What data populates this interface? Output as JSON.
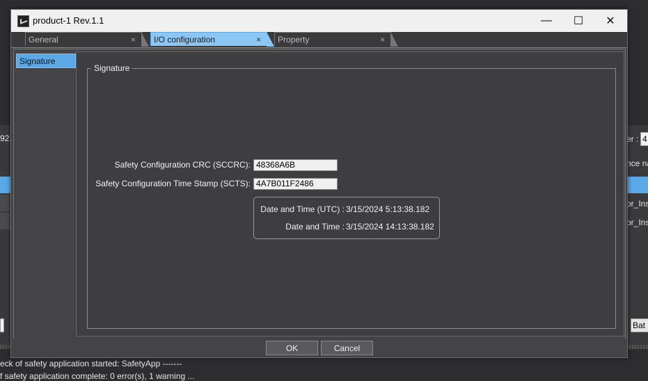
{
  "background": {
    "left_fragment": "92.1",
    "right_label": "er :",
    "right_value": "4",
    "column_fragment": "nce na",
    "row1": "or_Ins",
    "row2": "or_Ins",
    "button_fragment": "Bat",
    "log_line1": "eck of safety application started: SafetyApp -------",
    "log_line2": "f safety application complete: 0 error(s), 1 warning ..."
  },
  "window": {
    "title": "product-1 Rev.1.1",
    "minimize": "—",
    "maximize": "☐",
    "close": "✕"
  },
  "tabs": [
    {
      "label": "General",
      "close": "×",
      "active": false
    },
    {
      "label": "I/O configuration",
      "close": "×",
      "active": true
    },
    {
      "label": "Property",
      "close": "×",
      "active": false
    }
  ],
  "nav": {
    "items": [
      {
        "label": "Signature"
      }
    ]
  },
  "signature": {
    "group_title": "Signature",
    "crc_label": "Safety Configuration CRC (SCCRC):",
    "crc_value": "48368A6B",
    "ts_label": "Safety Configuration Time Stamp (SCTS):",
    "ts_value": "4A7B011F2486",
    "utc_label": "Date and Time (UTC) :",
    "utc_value": "3/15/2024 5:13:38.182",
    "local_label": "Date and Time :",
    "local_value": "3/15/2024 14:13:38.182"
  },
  "buttons": {
    "ok": "OK",
    "cancel": "Cancel"
  }
}
